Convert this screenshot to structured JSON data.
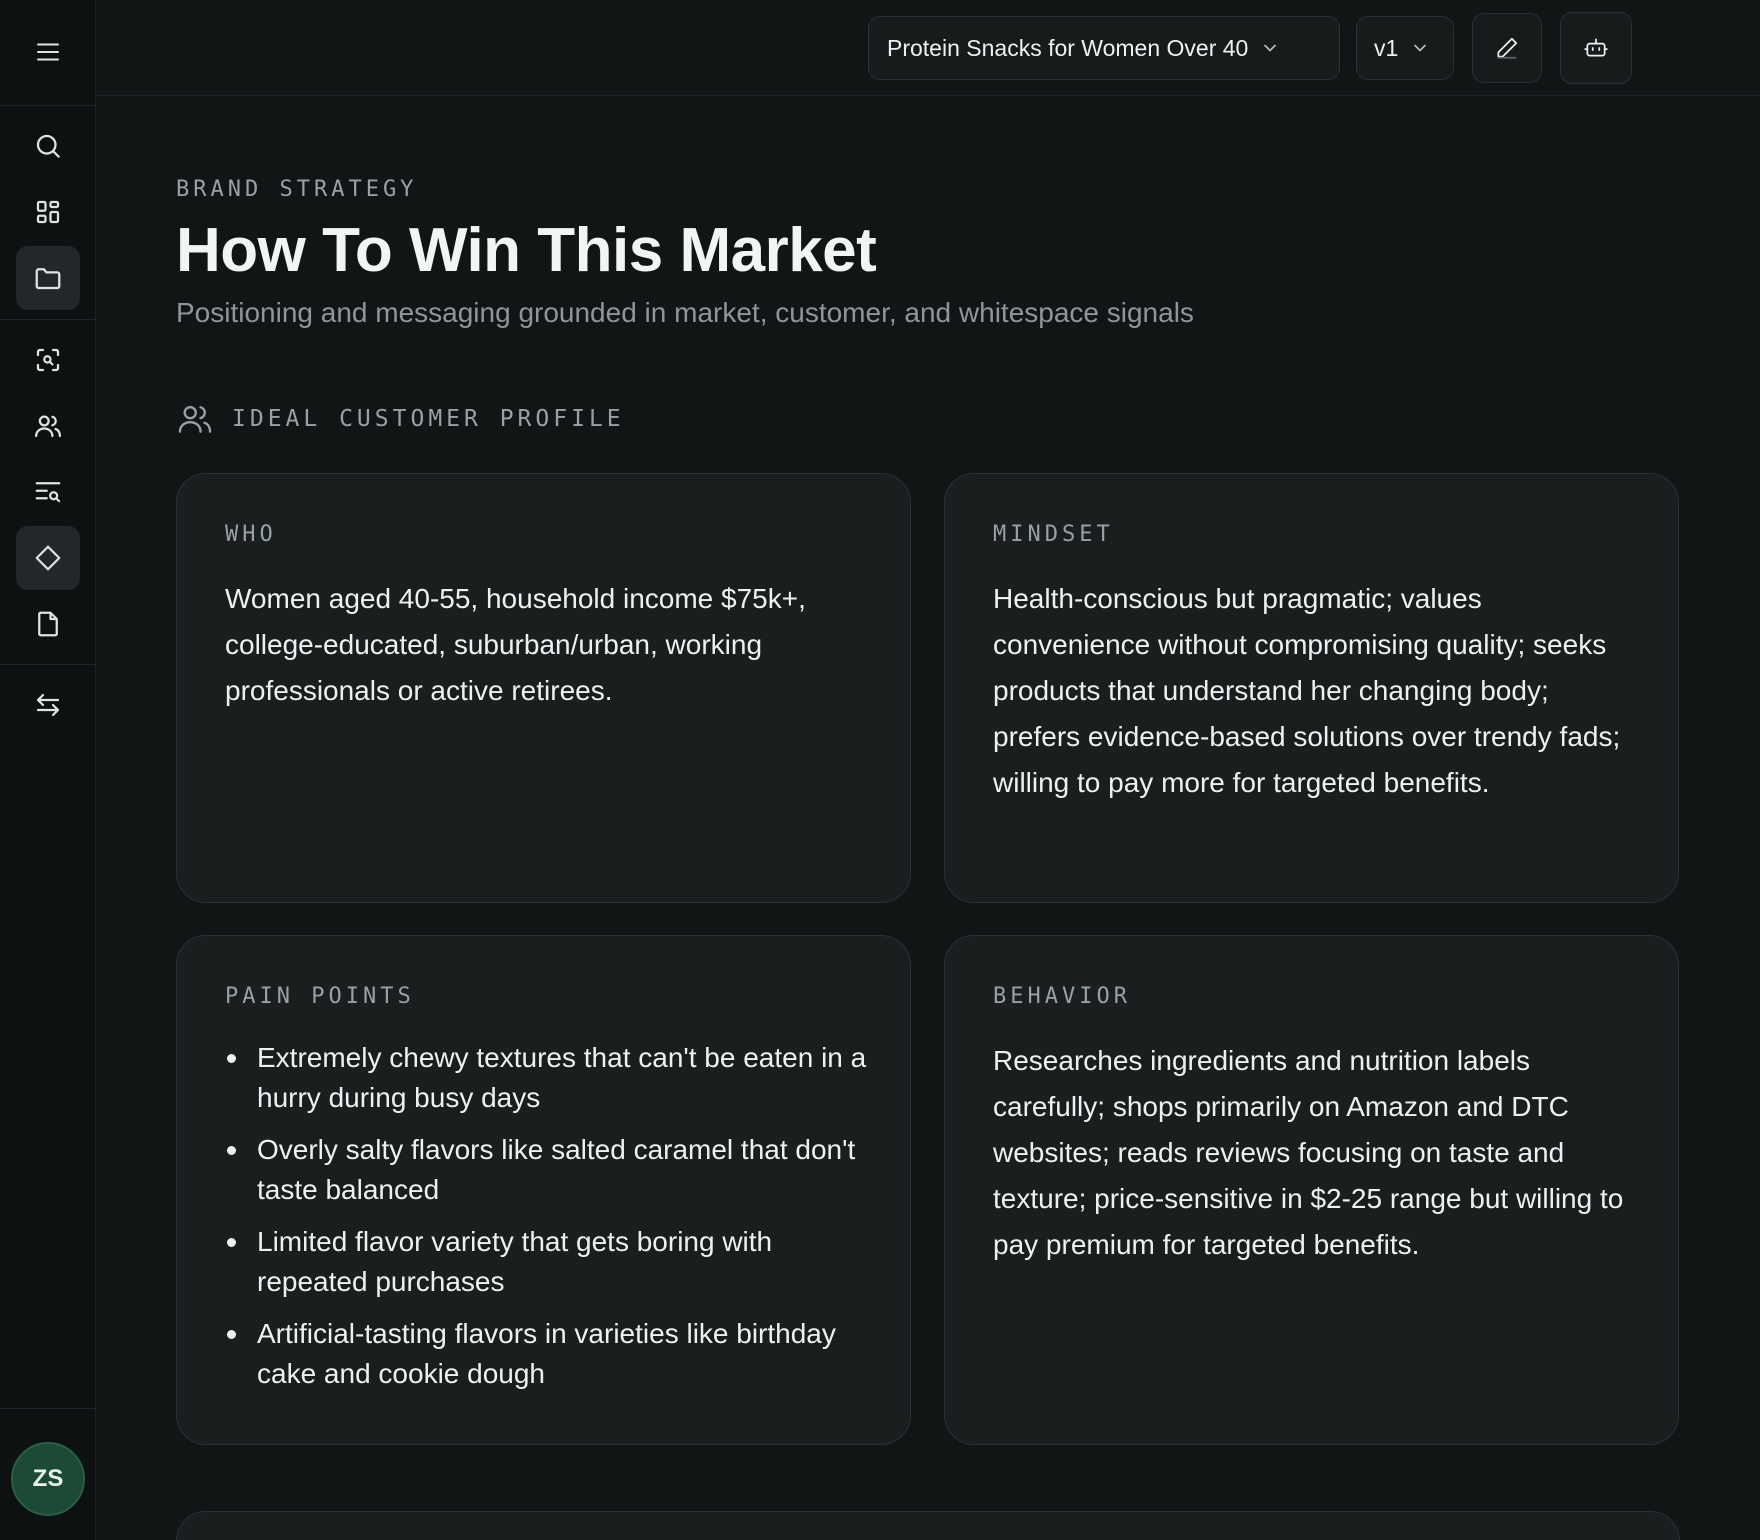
{
  "header": {
    "project_selector": "Protein Snacks for Women Over 40",
    "version_selector": "v1"
  },
  "sidebar": {
    "icons": [
      "menu-icon",
      "search-icon",
      "dashboard-icon",
      "folder-icon",
      "scan-search-icon",
      "users-icon",
      "text-search-icon",
      "diamond-icon",
      "file-icon",
      "swap-icon"
    ],
    "user_initials": "ZS"
  },
  "page": {
    "eyebrow": "BRAND STRATEGY",
    "title": "How To Win This Market",
    "subtitle": "Positioning and messaging grounded in market, customer, and whitespace signals"
  },
  "icp": {
    "heading": "IDEAL CUSTOMER PROFILE",
    "who": {
      "label": "WHO",
      "text": "Women aged 40-55, household income $75k+, college-educated, suburban/urban, working professionals or active retirees."
    },
    "mindset": {
      "label": "MINDSET",
      "text": "Health-conscious but pragmatic; values convenience without compromising quality; seeks products that understand her changing body; prefers evidence-based solutions over trendy fads; willing to pay more for targeted benefits."
    },
    "pain_points": {
      "label": "PAIN POINTS",
      "items": [
        "Extremely chewy textures that can't be eaten in a hurry during busy days",
        "Overly salty flavors like salted caramel that don't taste balanced",
        "Limited flavor variety that gets boring with repeated purchases",
        "Artificial-tasting flavors in varieties like birthday cake and cookie dough"
      ]
    },
    "behavior": {
      "label": "BEHAVIOR",
      "text": "Researches ingredients and nutrition labels carefully; shops primarily on Amazon and DTC websites; reads reviews focusing on taste and texture; price-sensitive in $2-25 range but willing to pay premium for targeted benefits."
    }
  }
}
